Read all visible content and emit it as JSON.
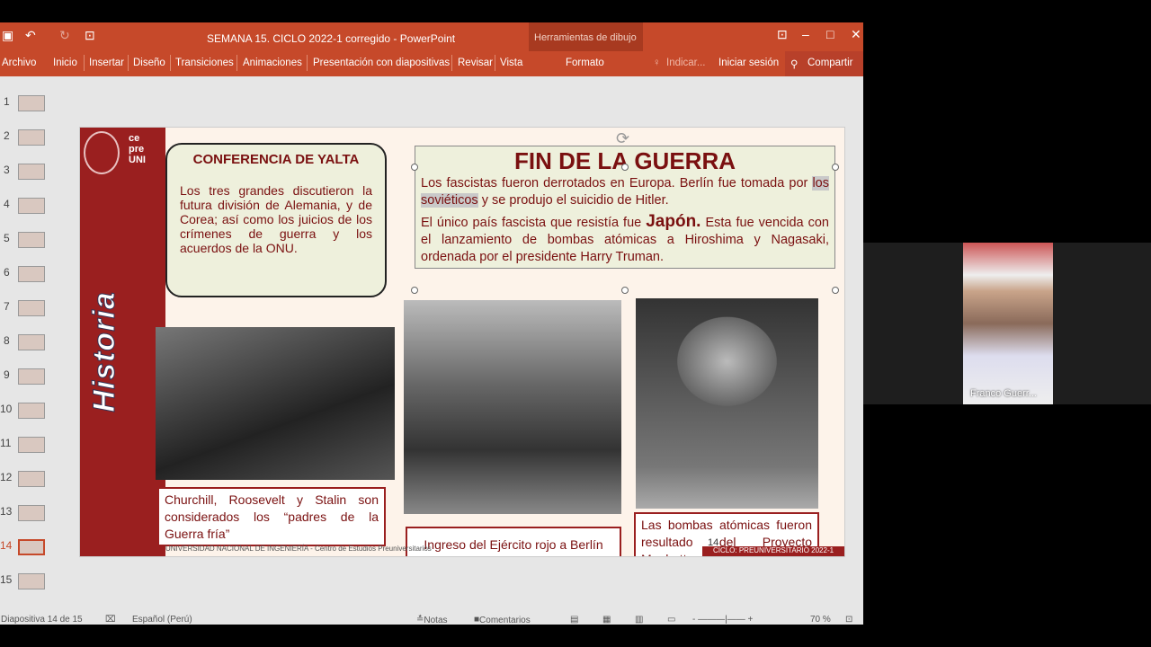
{
  "window": {
    "title": "SEMANA 15. CICLO 2022-1 corregido - PowerPoint",
    "tools_label": "Herramientas de dibujo"
  },
  "ribbon": {
    "tabs": [
      "Archivo",
      "Inicio",
      "Insertar",
      "Diseño",
      "Transiciones",
      "Animaciones",
      "Presentación con diapositivas",
      "Revisar",
      "Vista"
    ],
    "formato": "Formato",
    "tell": "Indicar...",
    "signin": "Iniciar sesión",
    "share": "Compartir"
  },
  "thumbs": [
    "1",
    "2",
    "3",
    "4",
    "5",
    "6",
    "7",
    "8",
    "9",
    "10",
    "11",
    "12",
    "13",
    "14",
    "15"
  ],
  "slide": {
    "logo_text": "ce pre UNI",
    "vertical": "Historia",
    "yalta_title": "CONFERENCIA DE YALTA",
    "yalta_body": "Los tres grandes discutieron la futura división de Alemania, y de Corea; así como los juicios de los crímenes de guerra y los acuerdos de la ONU.",
    "fin_title": "FIN DE LA GUERRA",
    "fin_p1a": "Los fascistas fueron derrotados en Europa. Berlín fue tomada por ",
    "fin_p1hl": "los soviéticos",
    "fin_p1b": " y se produjo el suicidio de Hitler.",
    "fin_p2a": "El único país fascista que resistía fue ",
    "fin_p2bold": "Japón.",
    "fin_p2b": " Esta fue vencida con el lanzamiento de bombas atómicas a Hiroshima y Nagasaki, ordenada por el presidente Harry Truman.",
    "cap1": "Churchill, Roosevelt y Stalin son considerados los “padres de la Guerra fría”",
    "cap2": "Ingreso del Ejército rojo a Berlín",
    "cap3": "Las bombas atómicas fueron resultado del Proyecto Manhattan",
    "page_num": "14",
    "footer_left": "UNIVERSIDAD NACIONAL DE INGENIERÍA - Centro de Estudios Preuniversitarios",
    "footer_right": "CICLO: PREUNIVERSITARIO 2022-1"
  },
  "status": {
    "slide": "Diapositiva 14 de 15",
    "lang": "Español (Perú)",
    "notes": "Notas",
    "comments": "Comentarios",
    "zoom": "70 %"
  },
  "video": {
    "name": "Franco Guerr..."
  }
}
